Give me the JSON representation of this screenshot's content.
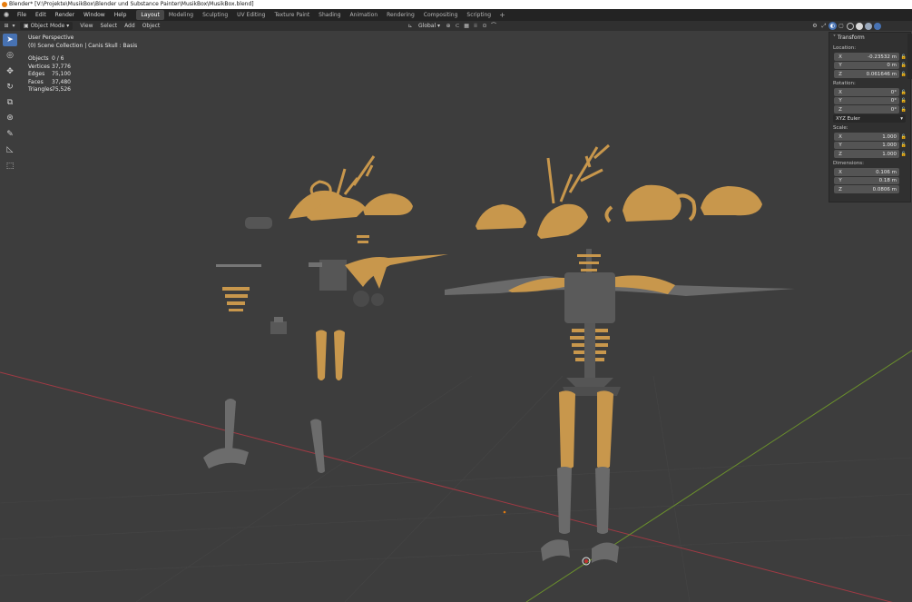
{
  "window_title": "Blender* [V:\\Projekte\\MusikBox\\Blender und Substance Painter\\MusikBox\\MusikBox.blend]",
  "menu": [
    "File",
    "Edit",
    "Render",
    "Window",
    "Help"
  ],
  "workspaces": [
    "Layout",
    "Modeling",
    "Sculpting",
    "UV Editing",
    "Texture Paint",
    "Shading",
    "Animation",
    "Rendering",
    "Compositing",
    "Scripting"
  ],
  "active_workspace": "Layout",
  "add_workspace": "+",
  "header": {
    "mode": "Object Mode",
    "view": "View",
    "select": "Select",
    "add": "Add",
    "object": "Object",
    "orientation": "Global"
  },
  "overlay": {
    "view_name": "User Perspective",
    "collection": "(0) Scene Collection | Canis Skull : Basis",
    "stats": [
      {
        "label": "Objects",
        "value": "0 / 6"
      },
      {
        "label": "Vertices",
        "value": "37,776"
      },
      {
        "label": "Edges",
        "value": "75,100"
      },
      {
        "label": "Faces",
        "value": "37,480"
      },
      {
        "label": "Triangles",
        "value": "75,526"
      }
    ]
  },
  "transform": {
    "title": "Transform",
    "location_label": "Location:",
    "location": [
      {
        "axis": "X",
        "value": "-0.23532 m"
      },
      {
        "axis": "Y",
        "value": "0 m"
      },
      {
        "axis": "Z",
        "value": "0.061646 m"
      }
    ],
    "rotation_label": "Rotation:",
    "rotation": [
      {
        "axis": "X",
        "value": "0°"
      },
      {
        "axis": "Y",
        "value": "0°"
      },
      {
        "axis": "Z",
        "value": "0°"
      }
    ],
    "rotation_mode": "XYZ Euler",
    "scale_label": "Scale:",
    "scale": [
      {
        "axis": "X",
        "value": "1.000"
      },
      {
        "axis": "Y",
        "value": "1.000"
      },
      {
        "axis": "Z",
        "value": "1.000"
      }
    ],
    "dimensions_label": "Dimensions:",
    "dimensions": [
      {
        "axis": "X",
        "value": "0.106 m"
      },
      {
        "axis": "Y",
        "value": "0.18 m"
      },
      {
        "axis": "Z",
        "value": "0.0806 m"
      }
    ]
  },
  "colors": {
    "bone": "#c8974c",
    "metal": "#5c5c5c",
    "x_axis": "#a03a44",
    "y_axis": "#6a8f2c",
    "accent": "#4772b3"
  },
  "icons": {
    "toolbar": [
      "select-box-icon",
      "cursor-icon",
      "move-icon",
      "rotate-icon",
      "scale-icon",
      "transform-icon",
      "annotate-icon",
      "measure-icon",
      "add-cube-icon"
    ]
  }
}
